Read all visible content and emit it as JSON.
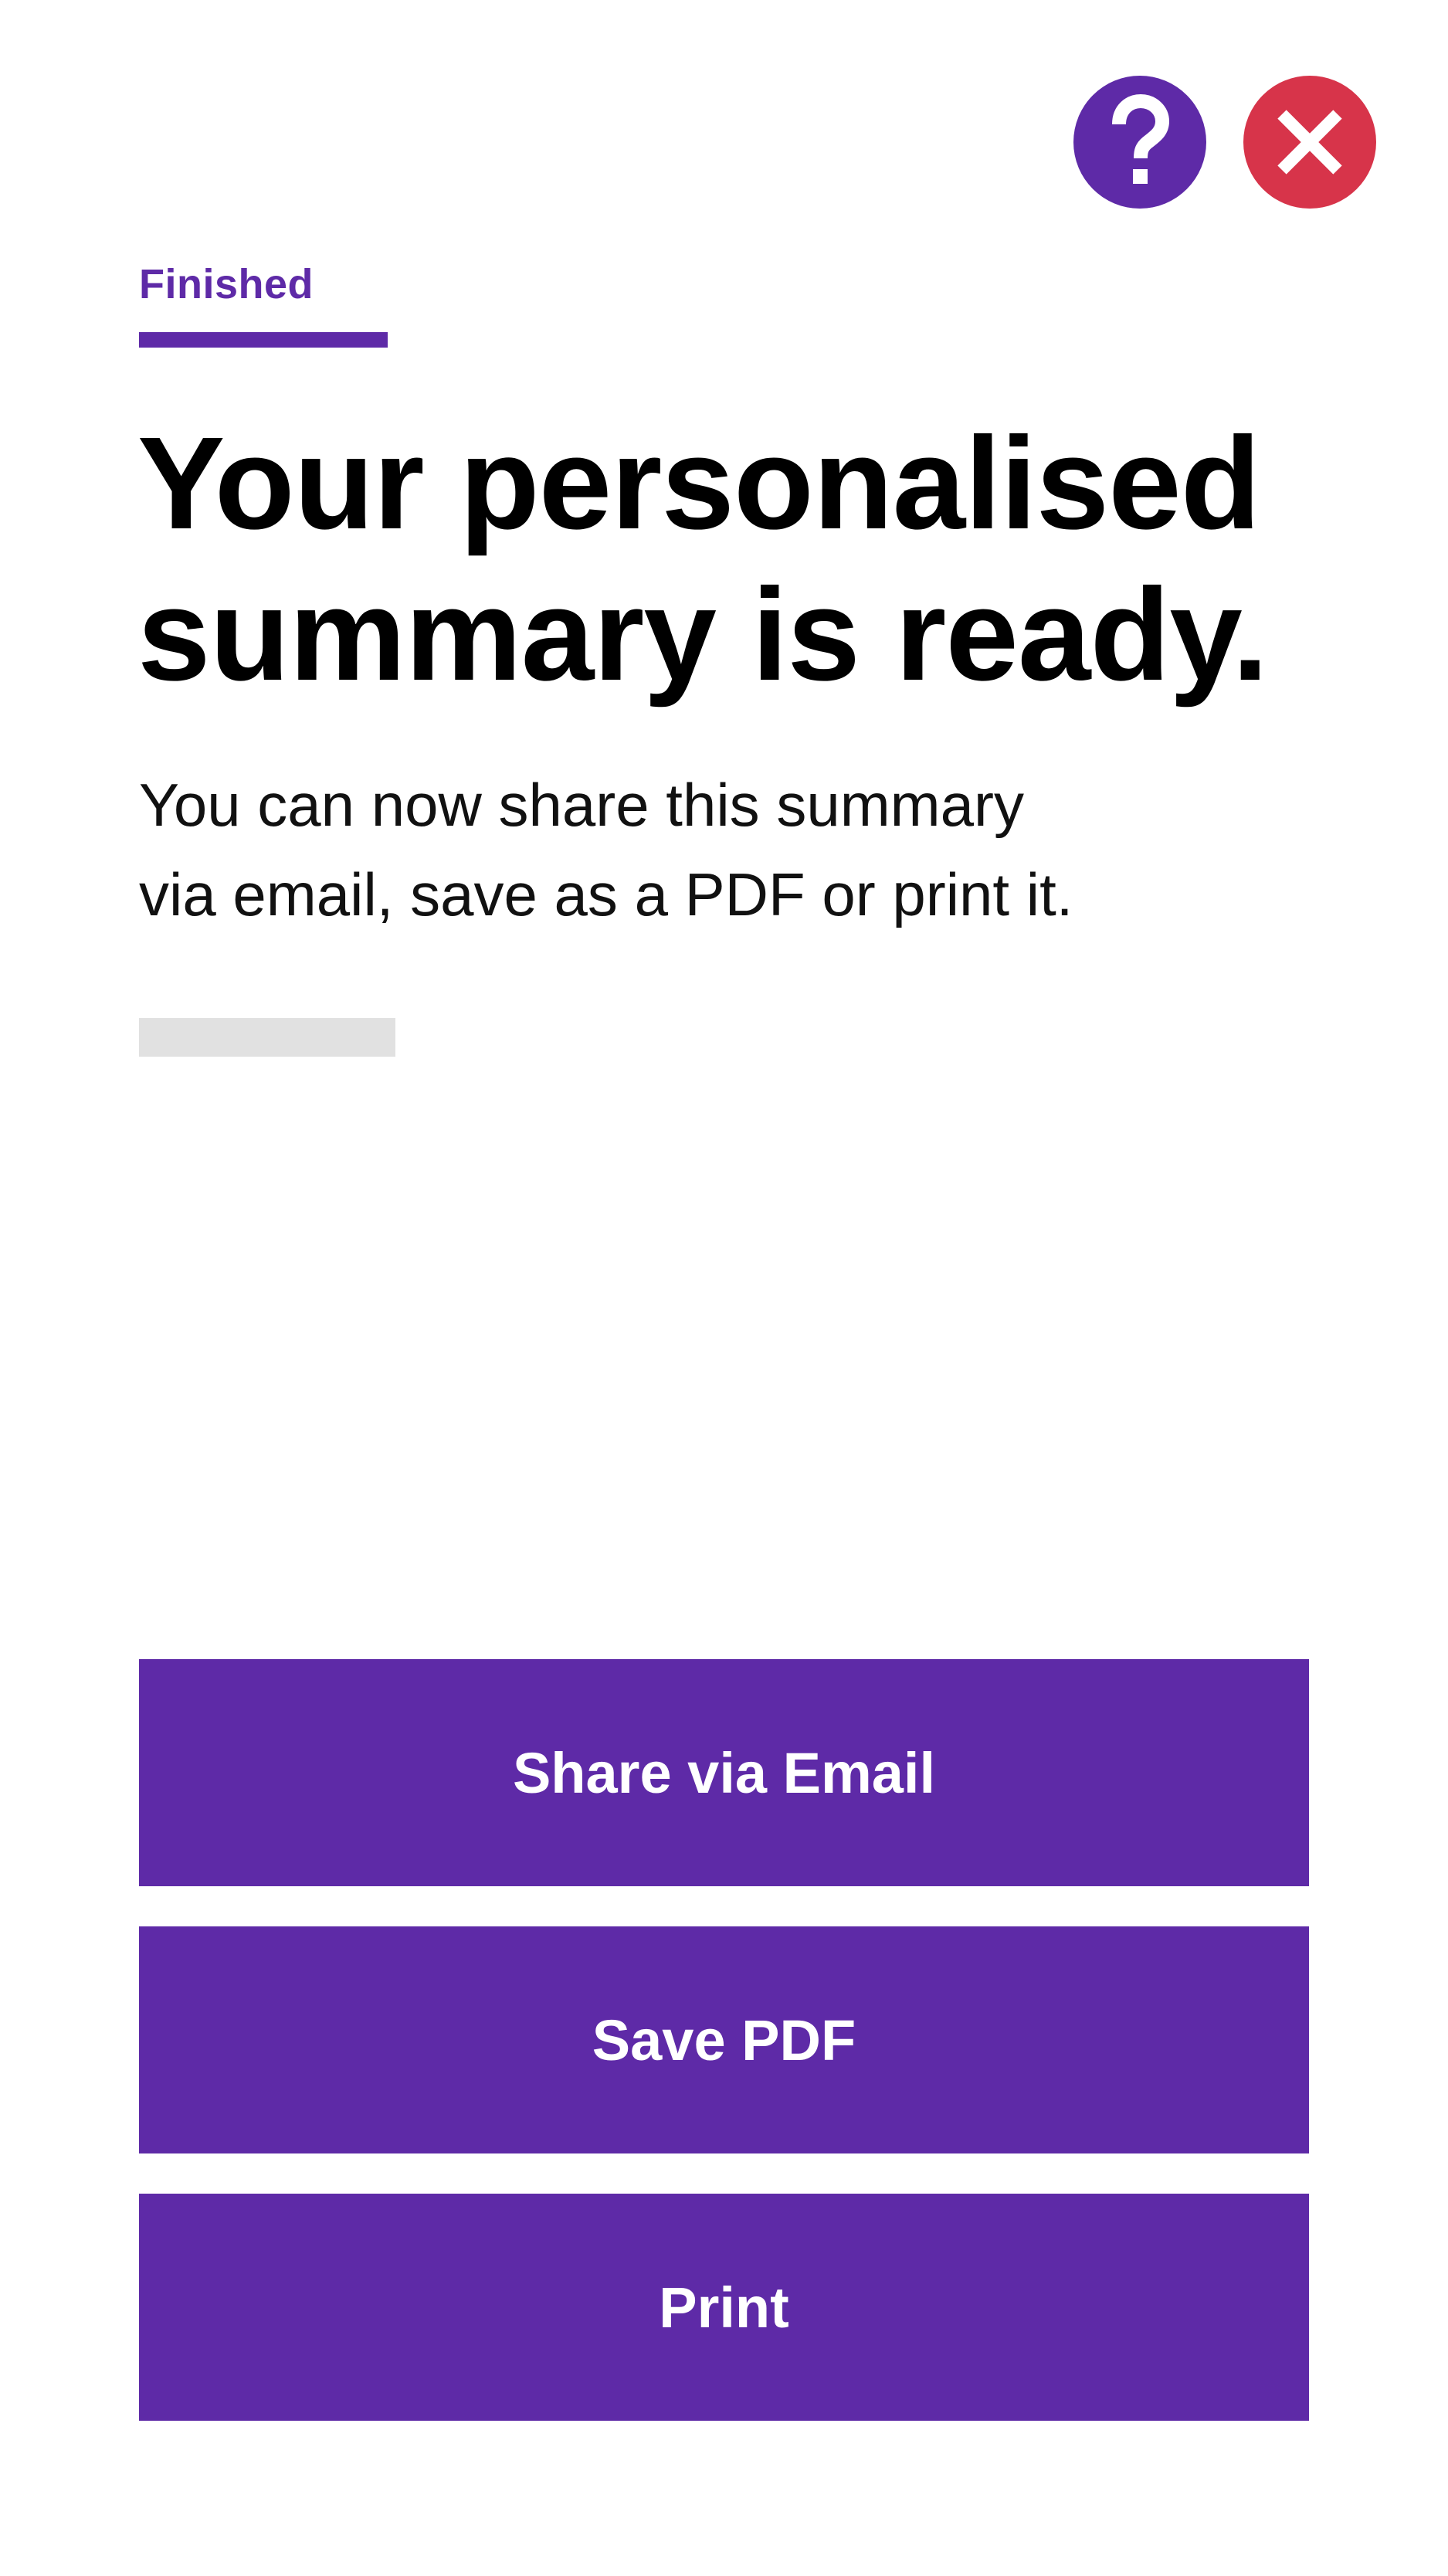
{
  "header": {
    "help_icon": "question-mark-icon",
    "close_icon": "close-x-icon"
  },
  "colors": {
    "accent": "#5e2aa7",
    "close": "#d7344a",
    "placeholder": "#e1e1e1"
  },
  "step": {
    "label": "Finished"
  },
  "main": {
    "title_line1": "Your personalised",
    "title_line2": "summary is ready.",
    "description_line1": "You can now share this summary",
    "description_line2": "via email, save as a PDF or print it."
  },
  "actions": {
    "share_email_label": "Share via Email",
    "save_pdf_label": "Save PDF",
    "print_label": "Print"
  }
}
